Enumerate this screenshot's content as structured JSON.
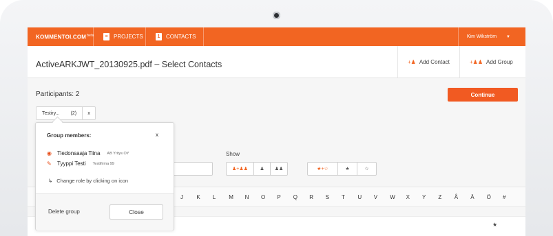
{
  "nav": {
    "logo": "KOMMENTOI.COM",
    "logo_badge": "beta",
    "projects": "PROJECTS",
    "contacts": "CONTACTS",
    "user": "Kim Wikström",
    "user_caret": "▼"
  },
  "header": {
    "title": "ActiveARKJWT_20130925.pdf – Select Contacts",
    "add_contact": "Add Contact",
    "add_group": "Add Group"
  },
  "participants": {
    "label": "Participants: 2",
    "continue_label": "Continue",
    "chip_label": "Testiry...",
    "chip_count": "(2)",
    "chip_remove": "x"
  },
  "popup": {
    "title": "Group members:",
    "close_x": "x",
    "members": [
      {
        "name": "Tiedonsaaja Tiina",
        "company": "AB Yritys OY",
        "icon": "eye-icon"
      },
      {
        "name": "Tyyppi Testi",
        "company": "Testifirma 99",
        "icon": "pencil-icon"
      }
    ],
    "hint": "Change role by clicking on icon",
    "delete_group": "Delete group",
    "close_label": "Close"
  },
  "filters": {
    "show_label": "Show"
  },
  "alphabet": [
    "J",
    "K",
    "L",
    "M",
    "N",
    "O",
    "P",
    "Q",
    "R",
    "S",
    "T",
    "U",
    "V",
    "W",
    "X",
    "Y",
    "Z",
    "Å",
    "Ä",
    "Ö",
    "#"
  ],
  "colors": {
    "accent": "#f26522",
    "continue": "#f15a22"
  }
}
